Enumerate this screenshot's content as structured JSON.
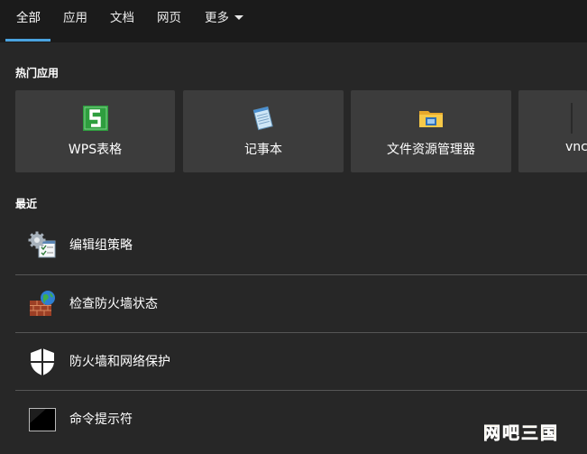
{
  "tabs": {
    "all": "全部",
    "apps": "应用",
    "docs": "文档",
    "web": "网页",
    "more": "更多"
  },
  "hot_apps": {
    "title": "热门应用",
    "items": [
      {
        "label": "WPS表格",
        "icon": "wps-spreadsheet-icon"
      },
      {
        "label": "记事本",
        "icon": "notepad-icon"
      },
      {
        "label": "文件资源管理器",
        "icon": "file-explorer-icon"
      },
      {
        "label": "vnc",
        "icon": "vnc-icon"
      }
    ]
  },
  "recent": {
    "title": "最近",
    "items": [
      {
        "label": "编辑组策略",
        "icon": "group-policy-icon"
      },
      {
        "label": "检查防火墙状态",
        "icon": "firewall-globe-icon"
      },
      {
        "label": "防火墙和网络保护",
        "icon": "shield-icon"
      },
      {
        "label": "命令提示符",
        "icon": "command-prompt-icon"
      }
    ]
  },
  "watermark": "网吧三国",
  "colors": {
    "background": "#272727",
    "tab_bar": "#1b1b1b",
    "tile": "#3c3c3c",
    "accent": "#4aa3df",
    "divider": "#565656",
    "wps_green": "#2e9e3e",
    "watermark": "#f5c24a"
  }
}
